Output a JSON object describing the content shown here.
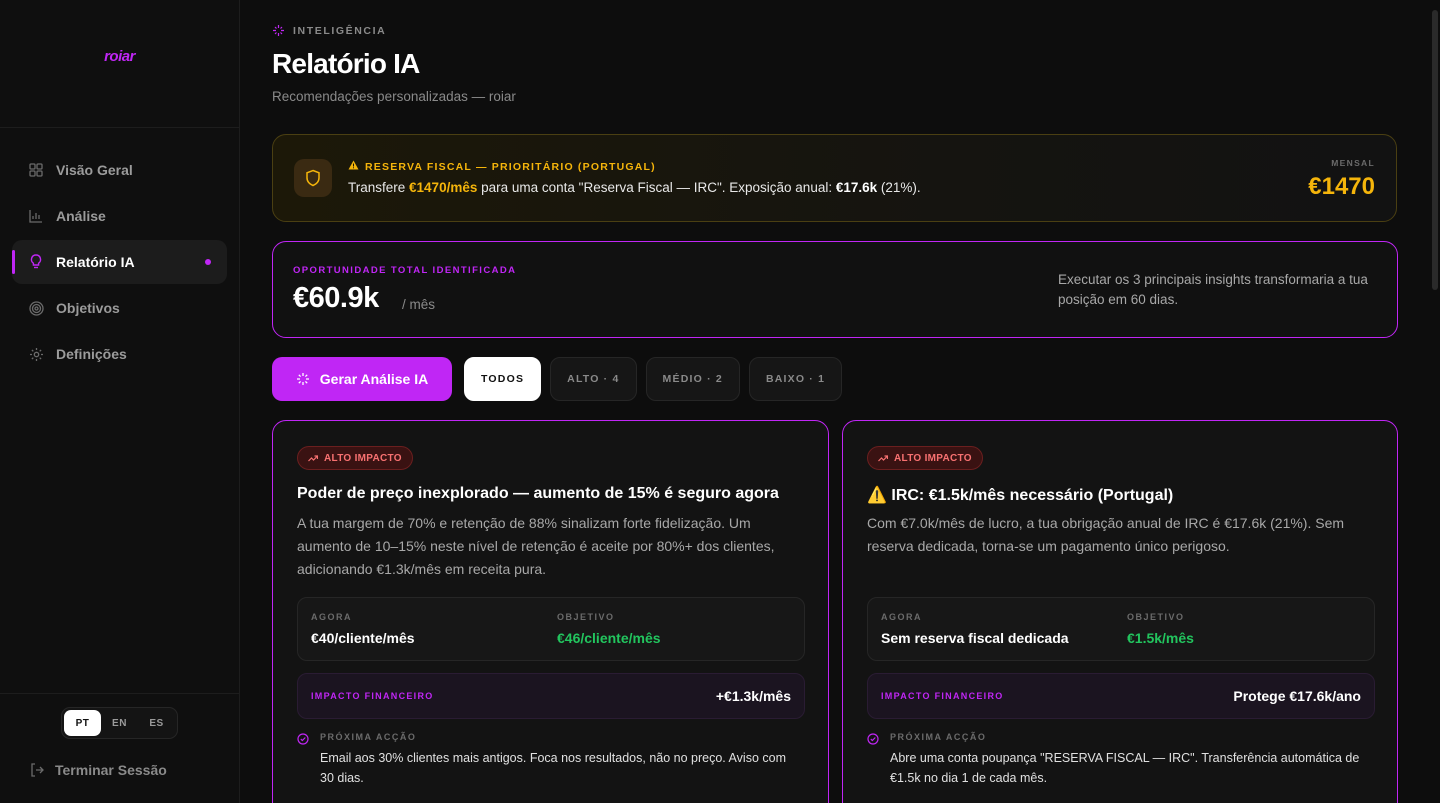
{
  "brand": {
    "logo": "roiar",
    "accent": "#c026f5"
  },
  "sidebar": {
    "items": [
      {
        "label": "Visão Geral",
        "icon": "grid-icon"
      },
      {
        "label": "Análise",
        "icon": "bar-chart-icon"
      },
      {
        "label": "Relatório IA",
        "icon": "lightbulb-icon",
        "active": true
      },
      {
        "label": "Objetivos",
        "icon": "target-icon"
      },
      {
        "label": "Definições",
        "icon": "gear-icon"
      }
    ],
    "languages": [
      "PT",
      "EN",
      "ES"
    ],
    "active_language": "PT",
    "logout": "Terminar Sessão"
  },
  "header": {
    "eyebrow": "INTELIGÊNCIA",
    "title": "Relatório IA",
    "subtitle": "Recomendações personalizadas — roiar"
  },
  "alert": {
    "title": "RESERVA FISCAL — PRIORITÁRIO (PORTUGAL)",
    "text_pre": "Transfere ",
    "highlight": "€1470/mês",
    "text_mid": " para uma conta \"Reserva Fiscal — IRC\". Exposição anual: ",
    "bold": "€17.6k",
    "text_post": " (21%).",
    "label": "MENSAL",
    "value": "€1470"
  },
  "opportunity": {
    "label": "OPORTUNIDADE TOTAL IDENTIFICADA",
    "value": "€60.9k",
    "unit": "/ mês",
    "description": "Executar os 3 principais insights transformaria a tua posição em 60 dias."
  },
  "toolbar": {
    "generate_label": "Gerar Análise IA",
    "filters": [
      {
        "label": "TODOS",
        "active": true
      },
      {
        "label": "ALTO · 4"
      },
      {
        "label": "MÉDIO · 2"
      },
      {
        "label": "BAIXO · 1"
      }
    ]
  },
  "cards": [
    {
      "badge": "ALTO IMPACTO",
      "title": "Poder de preço inexplorado — aumento de 15% é seguro agora",
      "description": "A tua margem de 70% e retenção de 88% sinalizam forte fidelização. Um aumento de 10–15% neste nível de retenção é aceite por 80%+ dos clientes, adicionando €1.3k/mês em receita pura.",
      "now_label": "AGORA",
      "now_value": "€40/cliente/mês",
      "goal_label": "OBJETIVO",
      "goal_value": "€46/cliente/mês",
      "impact_label": "IMPACTO FINANCEIRO",
      "impact_value": "+€1.3k/mês",
      "next_label": "PRÓXIMA ACÇÃO",
      "next_text": "Email aos 30% clientes mais antigos. Foca nos resultados, não no preço. Aviso com 30 dias."
    },
    {
      "badge": "ALTO IMPACTO",
      "title": "⚠️ IRC: €1.5k/mês necessário (Portugal)",
      "description": "Com €7.0k/mês de lucro, a tua obrigação anual de IRC é €17.6k (21%). Sem reserva dedicada, torna-se um pagamento único perigoso.",
      "now_label": "AGORA",
      "now_value": "Sem reserva fiscal dedicada",
      "goal_label": "OBJETIVO",
      "goal_value": "€1.5k/mês",
      "impact_label": "IMPACTO FINANCEIRO",
      "impact_value": "Protege €17.6k/ano",
      "next_label": "PRÓXIMA ACÇÃO",
      "next_text": "Abre uma conta poupança \"RESERVA FISCAL — IRC\". Transferência automática de €1.5k no dia 1 de cada mês."
    }
  ]
}
